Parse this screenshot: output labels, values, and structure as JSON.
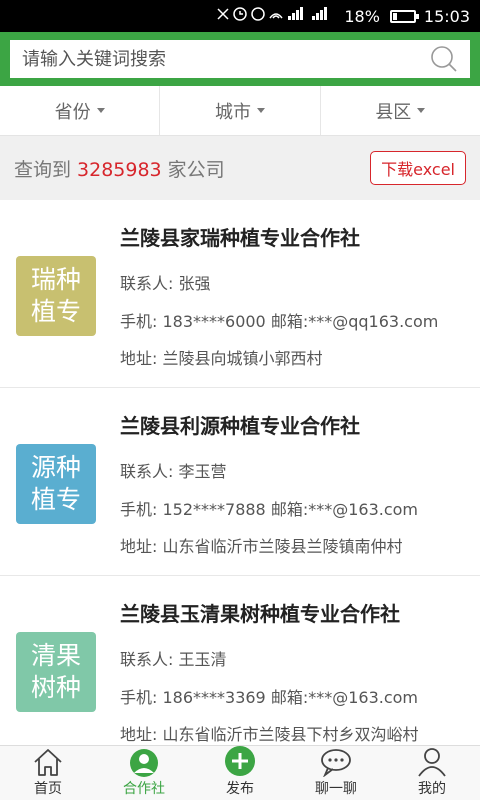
{
  "status_bar": {
    "battery": "18%",
    "time": "15:03",
    "battery_level": 0.18
  },
  "search": {
    "placeholder": "请输入关键词搜索"
  },
  "filters": [
    {
      "label": "省份"
    },
    {
      "label": "城市"
    },
    {
      "label": "县区"
    }
  ],
  "summary": {
    "prefix": "查询到",
    "count": "3285983",
    "suffix": "家公司",
    "download_label": "下载excel"
  },
  "companies": [
    {
      "name": "兰陵县家瑞种植专业合作社",
      "logo_line1": "瑞种",
      "logo_line2": "植专",
      "logo_color": "#c8c070",
      "contact": "联系人: 张强",
      "phone": "手机: 183****6000 邮箱:***@qq163.com",
      "address": "地址: 兰陵县向城镇小郭西村"
    },
    {
      "name": "兰陵县利源种植专业合作社",
      "logo_line1": "源种",
      "logo_line2": "植专",
      "logo_color": "#5aaed0",
      "contact": "联系人: 李玉营",
      "phone": "手机: 152****7888 邮箱:***@163.com",
      "address": "地址: 山东省临沂市兰陵县兰陵镇南仲村"
    },
    {
      "name": "兰陵县玉清果树种植专业合作社",
      "logo_line1": "清果",
      "logo_line2": "树种",
      "logo_color": "#80c8a8",
      "contact": "联系人: 王玉清",
      "phone": "手机: 186****3369 邮箱:***@163.com",
      "address": "地址: 山东省临沂市兰陵县下村乡双沟峪村"
    }
  ],
  "tabs": [
    {
      "label": "首页",
      "icon": "home-icon"
    },
    {
      "label": "合作社",
      "icon": "cooperative-icon"
    },
    {
      "label": "发布",
      "icon": "publish-icon"
    },
    {
      "label": "聊一聊",
      "icon": "chat-icon"
    },
    {
      "label": "我的",
      "icon": "profile-icon"
    }
  ],
  "colors": {
    "brand_green": "#3ca544",
    "accent_red": "#d7262c"
  }
}
